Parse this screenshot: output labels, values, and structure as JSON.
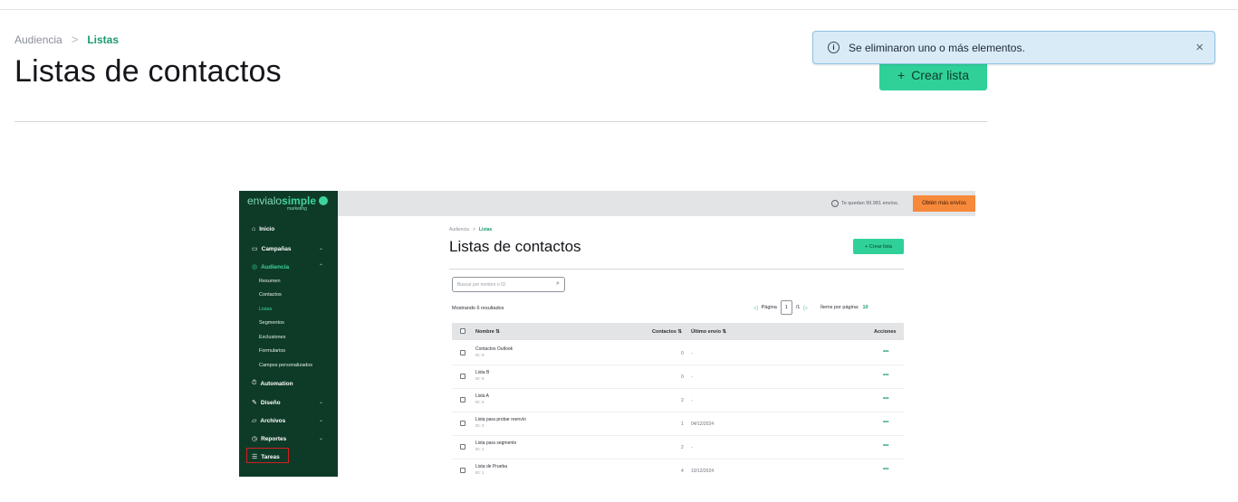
{
  "breadcrumb": {
    "root": "Audiencia",
    "separator": ">",
    "current": "Listas"
  },
  "header": {
    "title": "Listas de contactos",
    "create_button": "Crear lista",
    "create_icon": "+"
  },
  "toast": {
    "icon": "i",
    "message": "Se eliminaron uno o más elementos.",
    "close": "×"
  },
  "embedded": {
    "logo": {
      "part1": "envialo",
      "part2": "simple",
      "sub": "marketing"
    },
    "nav": {
      "inicio": "Inicio",
      "campanas": "Campañas",
      "audiencia": "Audiencia",
      "automation": "Automation",
      "diseno": "Diseño",
      "archivos": "Archivos",
      "reportes": "Reportes",
      "tareas": "Tareas"
    },
    "audiencia_sub": {
      "resumen": "Resumen",
      "contactos": "Contactos",
      "listas": "Listas",
      "segmentos": "Segmentos",
      "exclusiones": "Exclusiones",
      "formularios": "Formularios",
      "campos": "Campos personalizados"
    },
    "topbar": {
      "quota_text": "Te quedan 99.981 envíos.",
      "buy_button": "Obtén más envíos"
    },
    "breadcrumb": {
      "root": "Audiencia",
      "separator": ">",
      "current": "Listas"
    },
    "title": "Listas de contactos",
    "create_button": "+ Crear lista",
    "search_placeholder": "Buscar por nombre o ID",
    "results": "Mostrando 6 resultados",
    "pager": {
      "label": "Página",
      "page": "1",
      "total": "/1",
      "per_page_label": "Ítems por página:",
      "per_page": "10"
    },
    "table": {
      "headers": {
        "name": "Nombre ⇅",
        "contacts": "Contactos ⇅",
        "last_send": "Último envío ⇅",
        "actions": "Acciones"
      },
      "rows": [
        {
          "name": "Contactos Outlook",
          "id": "ID: 9",
          "contacts": "0",
          "last": "-",
          "actions": "•••"
        },
        {
          "name": "Lista B",
          "id": "ID: 6",
          "contacts": "0",
          "last": "-",
          "actions": "•••"
        },
        {
          "name": "Lista A",
          "id": "ID: 5",
          "contacts": "2",
          "last": "-",
          "actions": "•••"
        },
        {
          "name": "Lista para probar reenvío",
          "id": "ID: 3",
          "contacts": "1",
          "last": "04/12/2024",
          "actions": "•••"
        },
        {
          "name": "Lista para segmento",
          "id": "ID: 2",
          "contacts": "2",
          "last": "-",
          "actions": "•••"
        },
        {
          "name": "Lista de Prueba",
          "id": "ID: 1",
          "contacts": "4",
          "last": "10/12/2024",
          "actions": "•••"
        }
      ]
    }
  }
}
